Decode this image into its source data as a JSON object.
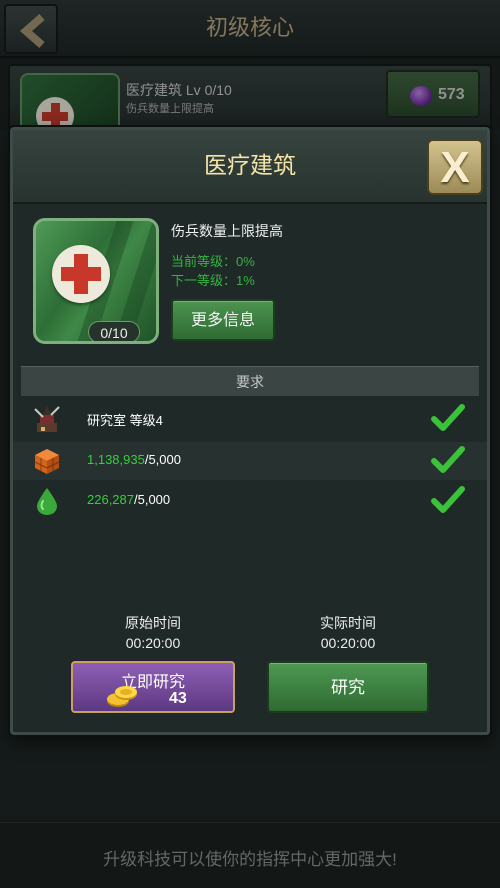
{
  "header": {
    "title": "初级核心"
  },
  "background_item": {
    "title": "医疗建筑 Lv 0/10",
    "subtitle": "伤兵数量上限提高",
    "price": "573"
  },
  "footer": {
    "hint": "升级科技可以使你的指挥中心更加强大!"
  },
  "modal": {
    "title": "医疗建筑",
    "close_label": "X",
    "level_badge": "0/10",
    "description": "伤兵数量上限提高",
    "current_level": "当前等级：0%",
    "next_level": "下一等级：1%",
    "more_info_label": "更多信息",
    "requirements_header": "要求",
    "requirements": [
      {
        "icon": "research-lab-icon",
        "label": "研究室  等级4",
        "met": true
      },
      {
        "icon": "brick-resource-icon",
        "have": "1,138,935",
        "need": "/5,000",
        "met": true
      },
      {
        "icon": "water-drop-resource-icon",
        "have": "226,287",
        "need": "/5,000",
        "met": true
      }
    ],
    "original_time_label": "原始时间",
    "original_time": "00:20:00",
    "actual_time_label": "实际时间",
    "actual_time": "00:20:00",
    "instant_research_label": "立即研究",
    "instant_research_cost": "43",
    "research_label": "研究"
  },
  "colors": {
    "title_gold": "#f4e4a8",
    "resource_green": "#33d03b",
    "check_green": "#3ac23a",
    "instant_purple": "#7a4ea0",
    "button_green": "#3f8543"
  }
}
